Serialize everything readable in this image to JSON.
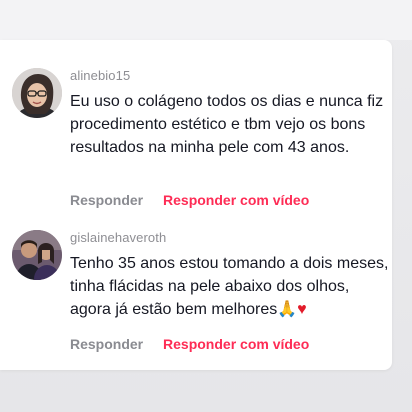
{
  "comments": [
    {
      "username": "alinebio15",
      "text": "Eu uso o colágeno todos os dias e nunca fiz procedimento estético e tbm vejo os bons resultados na minha pele com 43 anos.",
      "reply_label": "Responder",
      "reply_video_label": "Responder com vídeo",
      "avatar_icon": "profile-photo-woman-glasses"
    },
    {
      "username": "gislainehaveroth",
      "text": "Tenho 35 anos estou tomando a dois meses, tinha flácidas na pele abaixo dos olhos, agora já estão bem melhores",
      "emoji_1": "🙏",
      "emoji_2": "♥",
      "reply_label": "Responder",
      "reply_video_label": "Responder com vídeo",
      "avatar_icon": "profile-photo-couple"
    }
  ],
  "colors": {
    "accent": "#fe2c55",
    "muted": "#8a8b91",
    "text": "#161823"
  }
}
